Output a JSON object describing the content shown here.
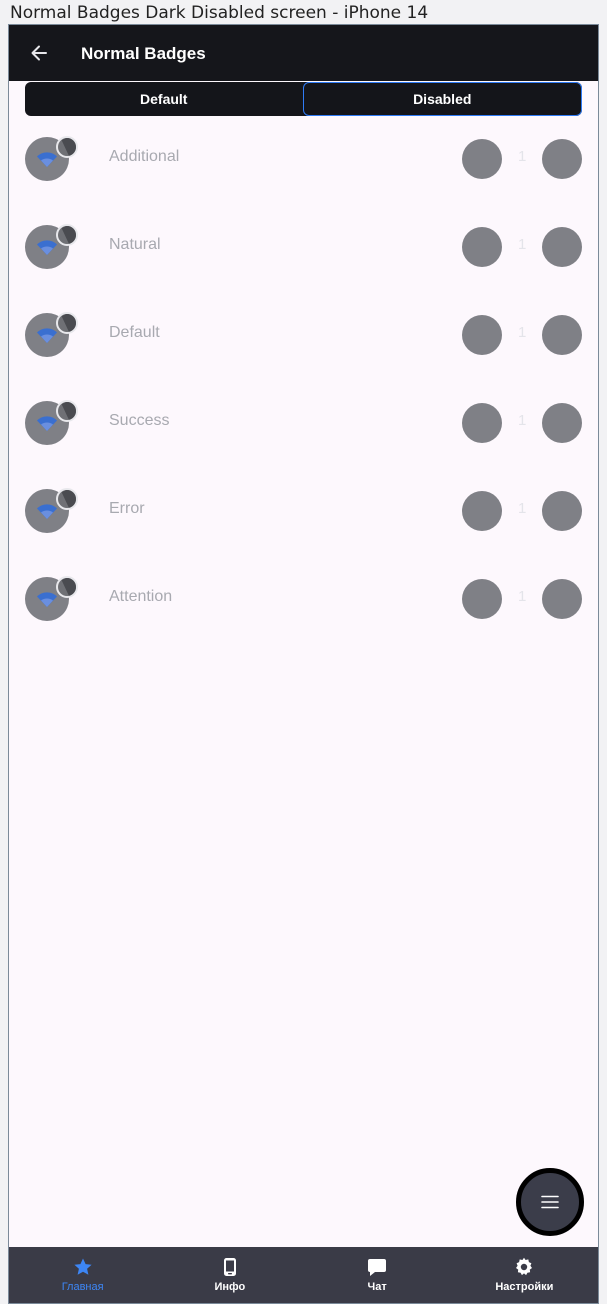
{
  "caption": "Normal Badges Dark Disabled screen - iPhone 14",
  "header": {
    "title": "Normal Badges"
  },
  "tabs": [
    {
      "label": "Default",
      "selected": false
    },
    {
      "label": "Disabled",
      "selected": true
    }
  ],
  "rows": [
    {
      "label": "Additional",
      "count": "1"
    },
    {
      "label": "Natural",
      "count": "1"
    },
    {
      "label": "Default",
      "count": "1"
    },
    {
      "label": "Success",
      "count": "1"
    },
    {
      "label": "Error",
      "count": "1"
    },
    {
      "label": "Attention",
      "count": "1"
    }
  ],
  "fab": {
    "icon": "menu-icon"
  },
  "bottom_nav": [
    {
      "label": "Главная",
      "icon": "star-icon",
      "active": true
    },
    {
      "label": "Инфо",
      "icon": "phone-icon",
      "active": false
    },
    {
      "label": "Чат",
      "icon": "chat-icon",
      "active": false
    },
    {
      "label": "Настройки",
      "icon": "gear-icon",
      "active": false
    }
  ],
  "colors": {
    "accent": "#2f7bf6",
    "appbar": "#15161b",
    "disabled_gray": "#7f8086",
    "background": "#fdf8fd",
    "bottom_nav": "#3a3b47"
  }
}
